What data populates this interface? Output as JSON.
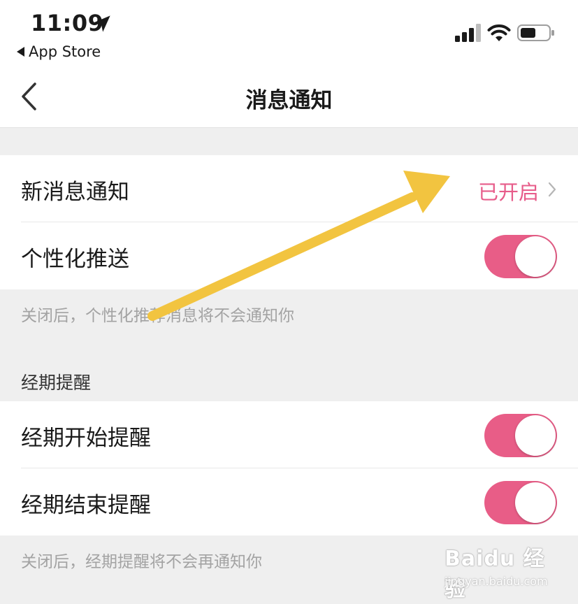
{
  "status_bar": {
    "time": "11:09",
    "back_app_label": "App Store"
  },
  "nav": {
    "title": "消息通知"
  },
  "rows": {
    "new_message": {
      "label": "新消息通知",
      "value": "已开启"
    },
    "personalized": {
      "label": "个性化推送",
      "on": true
    },
    "period_start": {
      "label": "经期开始提醒",
      "on": true
    },
    "period_end": {
      "label": "经期结束提醒",
      "on": true
    }
  },
  "captions": {
    "personalized_note": "关闭后，个性化推荐消息将不会通知你",
    "period_note": "关闭后，经期提醒将不会再通知你"
  },
  "sections": {
    "period_title": "经期提醒"
  },
  "watermark": {
    "brand": "Baidu 经验",
    "url": "jingyan.baidu.com"
  },
  "colors": {
    "accent": "#e85d87",
    "arrow": "#f2c440",
    "background": "#efefef"
  }
}
